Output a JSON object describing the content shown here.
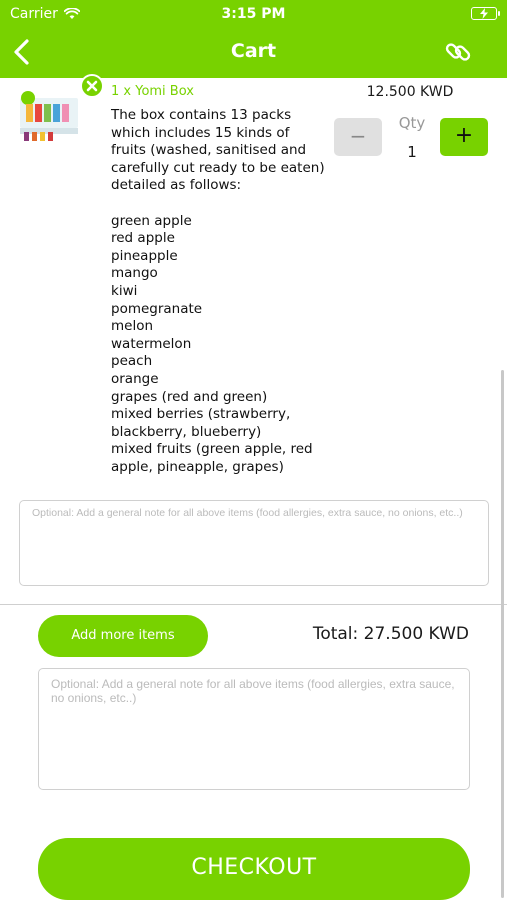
{
  "status_bar": {
    "carrier": "Carrier",
    "time": "3:15 PM"
  },
  "navbar": {
    "title": "Cart"
  },
  "item": {
    "title": "1 x Yomi Box",
    "price": "12.500 KWD",
    "qty_label": "Qty",
    "qty_value": "1",
    "minus_label": "−",
    "plus_label": "+",
    "description": "The box contains 13 packs which includes 15 kinds of fruits (washed, sanitised and carefully cut ready to be eaten) detailed as follows:\n\ngreen apple\nred apple\npineapple\nmango\nkiwi\npomegranate\nmelon\nwatermelon\npeach\norange\ngrapes (red and green)\nmixed berries (strawberry, blackberry, blueberry)\nmixed fruits (green apple, red apple, pineapple, grapes)"
  },
  "item_note": {
    "placeholder": "Optional: Add a general note for all above items (food allergies, extra sauce, no onions, etc..)"
  },
  "footer": {
    "add_more_label": "Add more items",
    "total": "Total: 27.500 KWD",
    "note_placeholder": "Optional: Add a general note for all above items (food allergies, extra sauce, no onions, etc..)",
    "checkout_label": "CHECKOUT"
  },
  "colors": {
    "accent": "#78d200",
    "muted_button": "#e0e0e0"
  },
  "icons": [
    "wifi-icon",
    "battery-charging-icon",
    "back-chevron-icon",
    "link-icon",
    "close-icon"
  ]
}
